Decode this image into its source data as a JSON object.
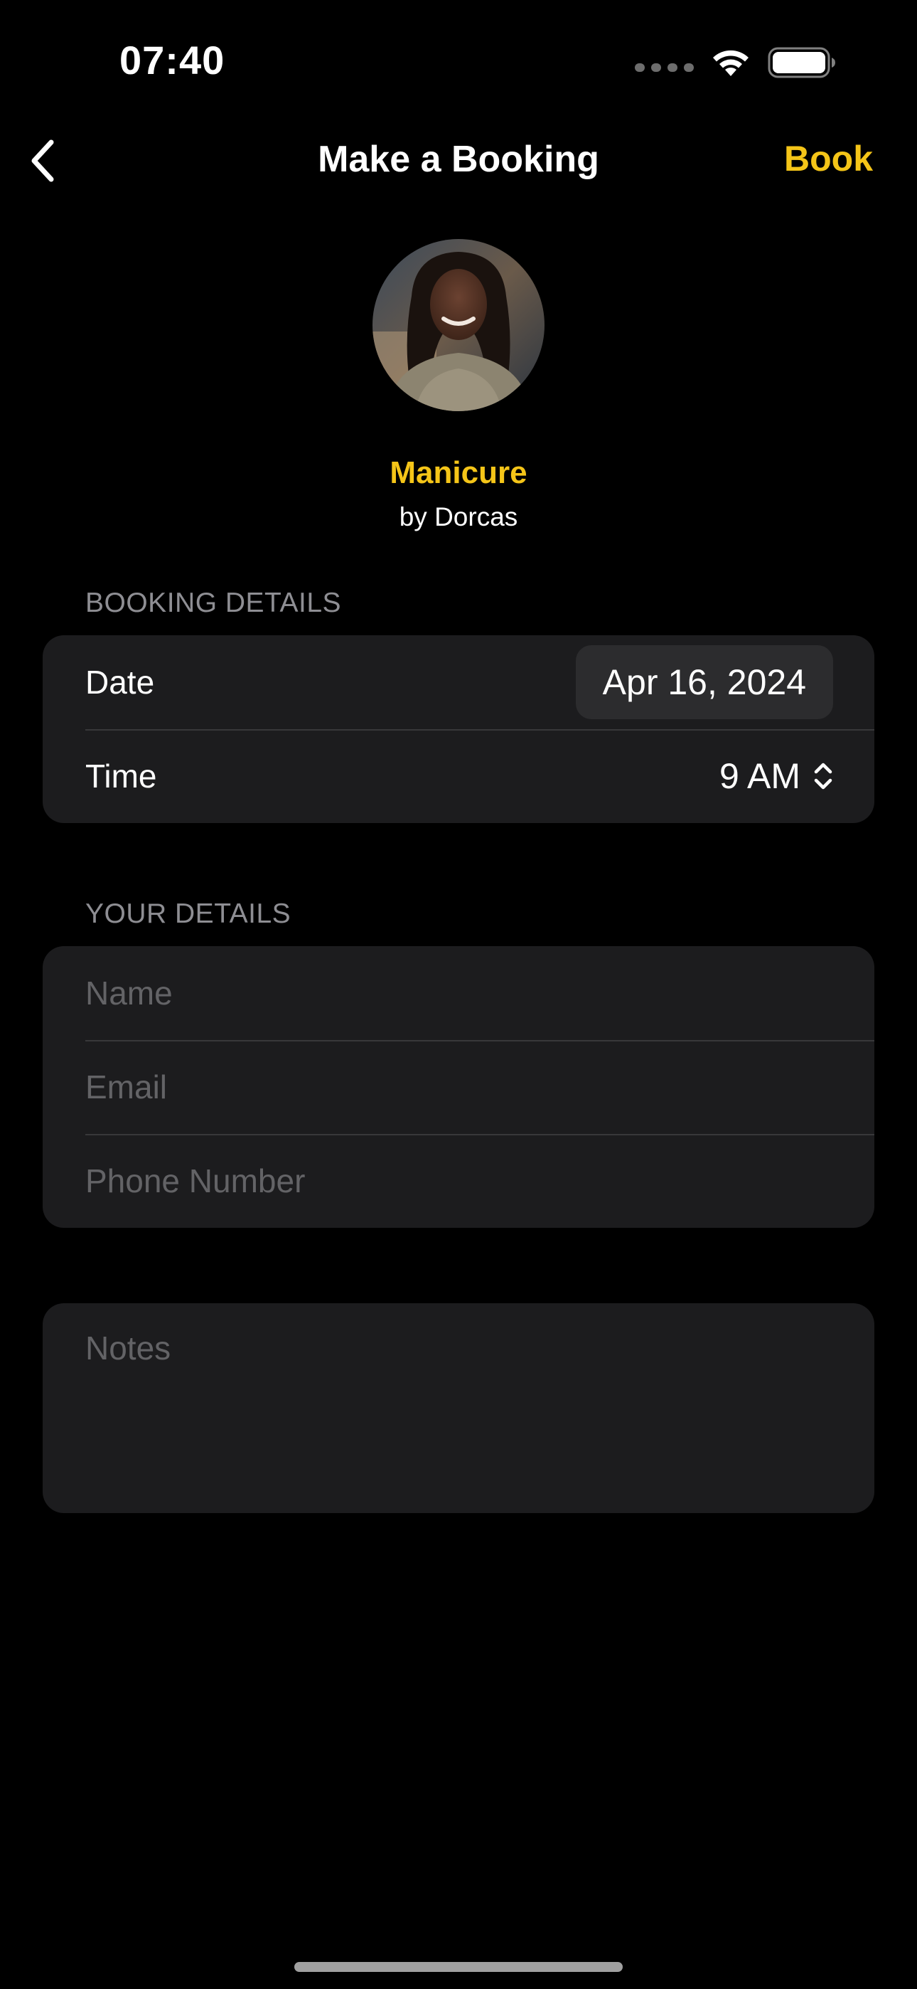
{
  "status_bar": {
    "time": "07:40"
  },
  "nav": {
    "title": "Make a Booking",
    "book_label": "Book"
  },
  "service": {
    "name": "Manicure",
    "provider": "by Dorcas"
  },
  "booking_details": {
    "header": "BOOKING DETAILS",
    "date_label": "Date",
    "date_value": "Apr 16, 2024",
    "time_label": "Time",
    "time_value": "9 AM"
  },
  "your_details": {
    "header": "YOUR DETAILS",
    "name_placeholder": "Name",
    "email_placeholder": "Email",
    "phone_placeholder": "Phone Number"
  },
  "notes": {
    "placeholder": "Notes"
  },
  "colors": {
    "accent": "#f5c518",
    "background": "#000000",
    "card": "#1c1c1e",
    "secondary_text": "#8e8e93",
    "placeholder": "#636366"
  },
  "icons": [
    "signal-icon",
    "wifi-icon",
    "battery-icon",
    "back-chevron-icon",
    "up-down-chevron-icon"
  ]
}
